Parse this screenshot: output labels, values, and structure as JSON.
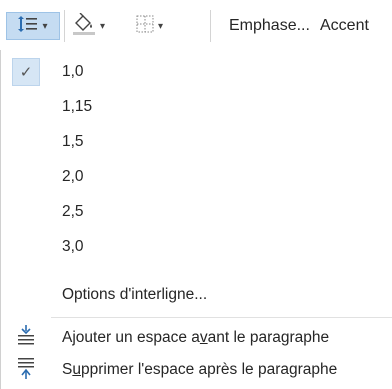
{
  "ribbon": {
    "line_spacing_icon": "line-spacing-icon",
    "shading_icon": "paint-bucket-icon",
    "borders_icon": "borders-icon",
    "styles": [
      "Emphase...",
      "Accent"
    ]
  },
  "menu": {
    "spacing_options": [
      {
        "label": "1,0",
        "checked": true
      },
      {
        "label": "1,15",
        "checked": false
      },
      {
        "label": "1,5",
        "checked": false
      },
      {
        "label": "2,0",
        "checked": false
      },
      {
        "label": "2,5",
        "checked": false
      },
      {
        "label": "3,0",
        "checked": false
      }
    ],
    "options_label": "Options d'interligne...",
    "add_space_before": {
      "prefix": "Ajouter un espace a",
      "mnemonic": "v",
      "suffix": "ant le paragraphe",
      "icon": "add-space-before-icon"
    },
    "remove_space_after": {
      "prefix": "S",
      "mnemonic": "u",
      "suffix": "pprimer l'espace après le paragraphe",
      "icon": "remove-space-after-icon"
    }
  },
  "colors": {
    "highlight": "#c5dcf2",
    "check_bg": "#d6e6f5",
    "text": "#262626",
    "icon_blue": "#2b6cb0"
  }
}
